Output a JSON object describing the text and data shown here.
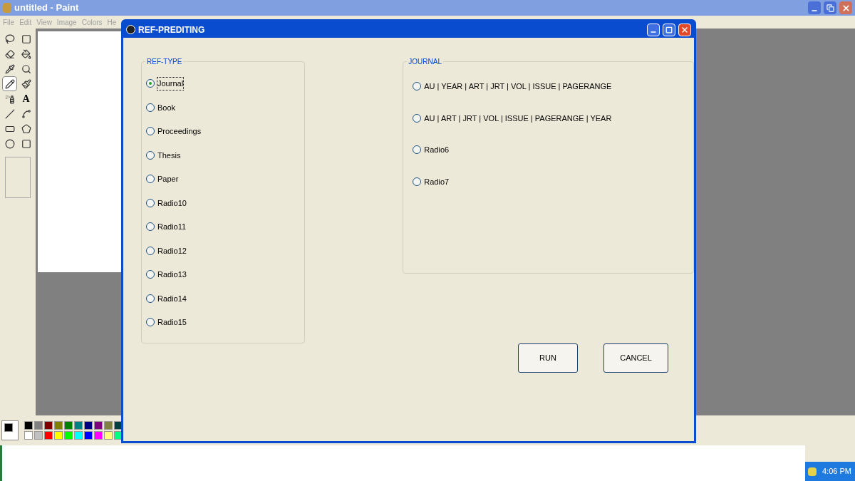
{
  "paint_window": {
    "title": "untitled - Paint",
    "menu": [
      "File",
      "Edit",
      "View",
      "Image",
      "Colors",
      "He"
    ],
    "tools": [
      {
        "kind": "free-select",
        "selected": false
      },
      {
        "kind": "select",
        "selected": false
      },
      {
        "kind": "eraser",
        "selected": false
      },
      {
        "kind": "fill",
        "selected": false
      },
      {
        "kind": "picker",
        "selected": false
      },
      {
        "kind": "magnifier",
        "selected": false
      },
      {
        "kind": "pencil",
        "selected": true
      },
      {
        "kind": "brush",
        "selected": false
      },
      {
        "kind": "airbrush",
        "selected": false
      },
      {
        "kind": "text",
        "selected": false,
        "glyph": "A"
      },
      {
        "kind": "line",
        "selected": false
      },
      {
        "kind": "curve",
        "selected": false
      },
      {
        "kind": "rectangle",
        "selected": false
      },
      {
        "kind": "polygon",
        "selected": false
      },
      {
        "kind": "ellipse",
        "selected": false
      },
      {
        "kind": "rounded-rectangle",
        "selected": false
      }
    ],
    "palette": [
      {
        "color": "#000000"
      },
      {
        "color": "#808080"
      },
      {
        "color": "#800000"
      },
      {
        "color": "#808000"
      },
      {
        "color": "#008000"
      },
      {
        "color": "#008080"
      },
      {
        "color": "#000080"
      },
      {
        "color": "#800080"
      },
      {
        "color": "#808040"
      },
      {
        "color": "#004040"
      },
      {
        "color": "#ffffff"
      },
      {
        "color": "#c0c0c0"
      },
      {
        "color": "#ff0000"
      },
      {
        "color": "#ffff00"
      },
      {
        "color": "#00ff00"
      },
      {
        "color": "#00ffff"
      },
      {
        "color": "#0000ff"
      },
      {
        "color": "#ff00ff"
      },
      {
        "color": "#ffff80"
      },
      {
        "color": "#00ff80"
      }
    ],
    "foreground": {
      "color": "#000000"
    }
  },
  "dialog": {
    "title": "REF-PREDITING",
    "ref_type": {
      "label": "REF-TYPE",
      "options": [
        {
          "label": "Journal",
          "selected": true
        },
        {
          "label": "Book",
          "selected": false
        },
        {
          "label": "Proceedings",
          "selected": false
        },
        {
          "label": "Thesis",
          "selected": false
        },
        {
          "label": "Paper",
          "selected": false
        },
        {
          "label": "Radio10",
          "selected": false
        },
        {
          "label": "Radio11",
          "selected": false
        },
        {
          "label": "Radio12",
          "selected": false
        },
        {
          "label": "Radio13",
          "selected": false
        },
        {
          "label": "Radio14",
          "selected": false
        },
        {
          "label": "Radio15",
          "selected": false
        }
      ]
    },
    "journal": {
      "label": "JOURNAL",
      "options": [
        {
          "label": "AU | YEAR | ART | JRT | VOL | ISSUE | PAGERANGE",
          "selected": false
        },
        {
          "label": "AU | ART | JRT | VOL | ISSUE | PAGERANGE |  YEAR",
          "selected": false
        },
        {
          "label": "Radio6",
          "selected": false
        },
        {
          "label": "Radio7",
          "selected": false
        }
      ]
    },
    "buttons": [
      "RUN",
      "CANCEL"
    ]
  },
  "taskbar": {
    "clock": "4:06 PM"
  }
}
